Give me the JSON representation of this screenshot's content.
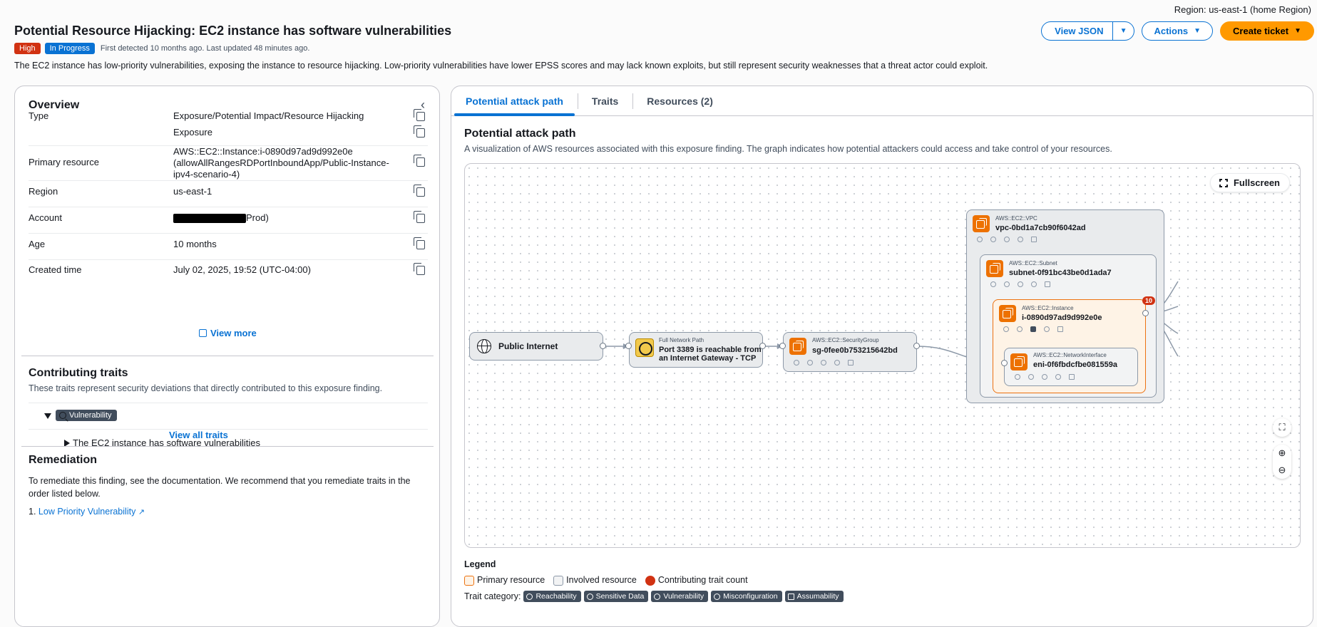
{
  "region": "Region: us-east-1 (home Region)",
  "title": "Potential Resource Hijacking: EC2 instance has software vulnerabilities",
  "severity": "High",
  "status": "In Progress",
  "detected": "First detected 10 months ago. Last updated 48 minutes ago.",
  "description": "The EC2 instance has low-priority vulnerabilities, exposing the instance to resource hijacking. Low-priority vulnerabilities have lower EPSS scores and may lack known exploits, but still represent security weaknesses that a threat actor could exploit.",
  "buttons": {
    "view_json": "View JSON",
    "actions": "Actions",
    "create_ticket": "Create ticket"
  },
  "overview": {
    "title": "Overview",
    "rows": [
      {
        "k": "Type",
        "v": "Exposure/Potential Impact/Resource Hijacking"
      },
      {
        "k": "",
        "v": "Exposure"
      },
      {
        "k": "Primary resource",
        "v": "AWS::EC2::Instance:i-0890d97ad9d992e0e (allowAllRangesRDPortInboundApp/Public-Instance-ipv4-scenario-4)"
      },
      {
        "k": "Region",
        "v": "us-east-1"
      },
      {
        "k": "Account",
        "v": "Prod)"
      },
      {
        "k": "Age",
        "v": "10 months"
      },
      {
        "k": "Created time",
        "v": "July 02, 2025, 19:52 (UTC-04:00)"
      }
    ],
    "view_more": "View more"
  },
  "traits": {
    "title": "Contributing traits",
    "subtitle": "These traits represent security deviations that directly contributed to this exposure finding.",
    "category": "Vulnerability",
    "item": "The EC2 instance has software vulnerabilities",
    "view_all": "View all traits"
  },
  "remediation": {
    "title": "Remediation",
    "text": "To remediate this finding, see the documentation. We recommend that you remediate traits in the order listed below.",
    "num": "1.",
    "link": "Low Priority Vulnerability"
  },
  "tabs": [
    "Potential attack path",
    "Traits",
    "Resources (2)"
  ],
  "attack_path": {
    "title": "Potential attack path",
    "subtitle": "A visualization of AWS resources associated with this exposure finding. The graph indicates how potential attackers could access and take control of your resources.",
    "fullscreen": "Fullscreen",
    "nodes": {
      "internet": "Public Internet",
      "path_type": "Full Network Path",
      "path_name_1": "Port 3389 is reachable from",
      "path_name_2": "an Internet Gateway - TCP",
      "sg_type": "AWS::EC2::SecurityGroup",
      "sg_name": "sg-0fee0b753215642bd",
      "vpc_type": "AWS::EC2::VPC",
      "vpc_name": "vpc-0bd1a7cb90f6042ad",
      "subnet_type": "AWS::EC2::Subnet",
      "subnet_name": "subnet-0f91bc43be0d1ada7",
      "instance_type": "AWS::EC2::Instance",
      "instance_name": "i-0890d97ad9d992e0e",
      "eni_type": "AWS::EC2::NetworkInterface",
      "eni_name": "eni-0f6fbdcfbe081559a",
      "trait_count": "10"
    }
  },
  "legend": {
    "title": "Legend",
    "primary": "Primary resource",
    "involved": "Involved resource",
    "count": "Contributing trait count",
    "cat_label": "Trait category:",
    "categories": [
      "Reachability",
      "Sensitive Data",
      "Vulnerability",
      "Misconfiguration",
      "Assumability"
    ]
  },
  "colors": {
    "accent": "#0972d3",
    "high": "#d13212",
    "primary_btn": "#ff9900",
    "aws_orange": "#ed7100"
  }
}
